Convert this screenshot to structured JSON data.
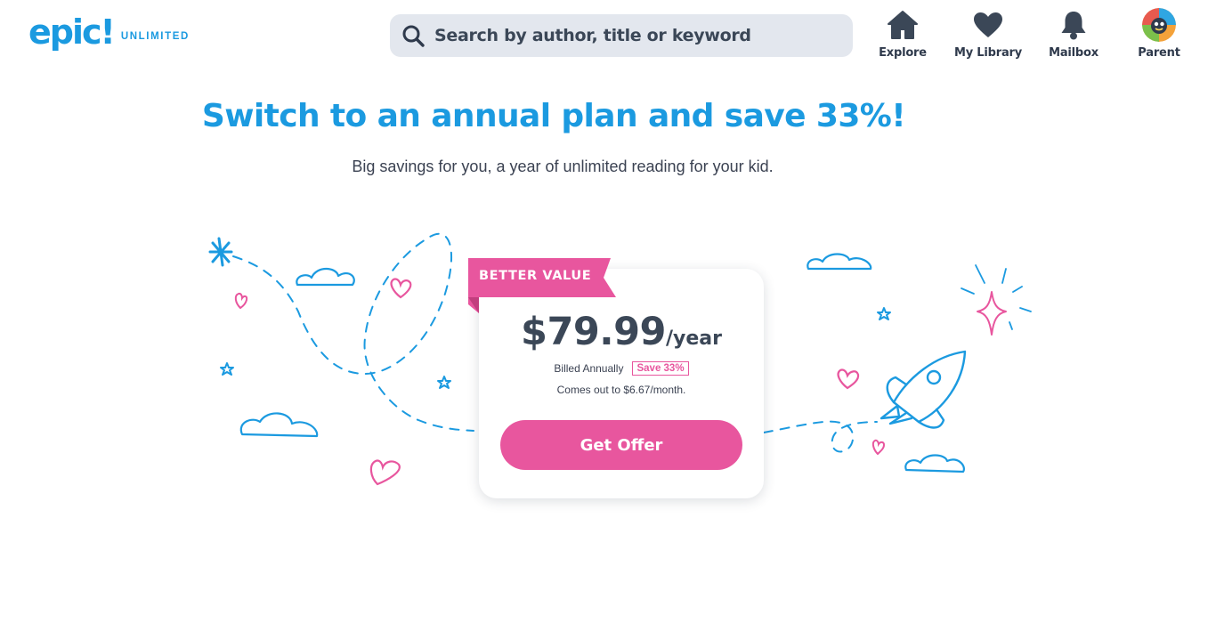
{
  "brand": {
    "logo_word": "epic!",
    "logo_tag": "UNLIMITED",
    "primary_color": "#1b9ae0",
    "accent_color": "#e8569e"
  },
  "search": {
    "placeholder": "Search by author, title or keyword",
    "icon": "search-icon"
  },
  "nav": {
    "items": [
      {
        "label": "Explore",
        "icon": "house-icon"
      },
      {
        "label": "My Library",
        "icon": "heart-icon"
      },
      {
        "label": "Mailbox",
        "icon": "bell-icon"
      },
      {
        "label": "Parent",
        "icon": "avatar"
      }
    ]
  },
  "hero": {
    "title": "Switch to an annual plan and save 33%!",
    "subtitle": "Big savings for you, a year of unlimited reading for your kid."
  },
  "offer": {
    "ribbon": "BETTER VALUE",
    "price": "$79.99",
    "period": "/year",
    "billed": "Billed Annually",
    "save_badge": "Save 33%",
    "monthly": "Comes out to $6.67/month.",
    "cta": "Get Offer"
  }
}
